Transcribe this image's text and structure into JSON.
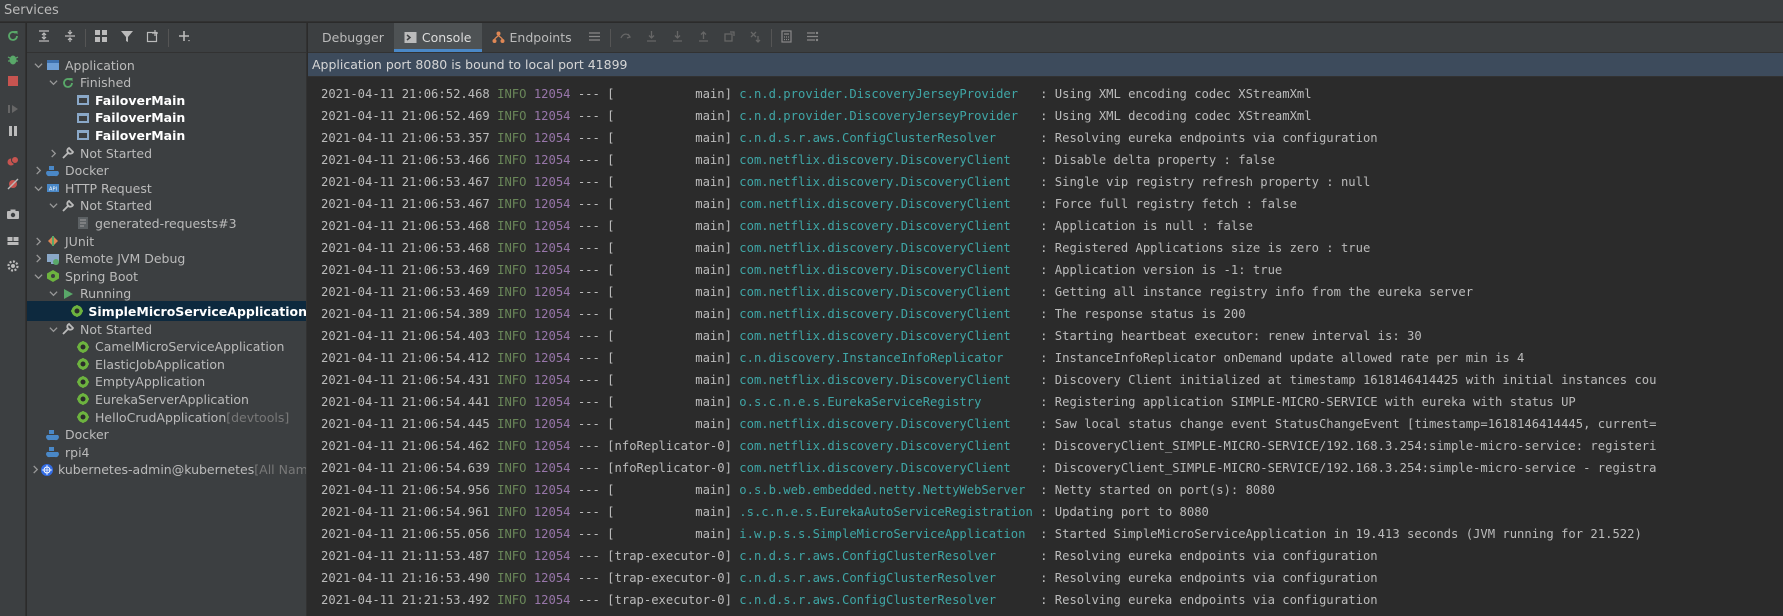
{
  "window": {
    "title": "Services"
  },
  "tree": {
    "rows": [
      {
        "label": "Application",
        "depth": 0,
        "arrow": "down",
        "icon": "app-icon"
      },
      {
        "label": "Finished",
        "depth": 1,
        "arrow": "down",
        "icon": "finished-icon"
      },
      {
        "label": "FailoverMain",
        "depth": 2,
        "arrow": "none",
        "icon": "main-class-icon",
        "bold": true
      },
      {
        "label": "FailoverMain",
        "depth": 2,
        "arrow": "none",
        "icon": "main-class-icon",
        "bold": true
      },
      {
        "label": "FailoverMain",
        "depth": 2,
        "arrow": "none",
        "icon": "main-class-icon",
        "bold": true
      },
      {
        "label": "Not Started",
        "depth": 1,
        "arrow": "right",
        "icon": "wrench-icon"
      },
      {
        "label": "Docker",
        "depth": 0,
        "arrow": "right",
        "icon": "docker-icon"
      },
      {
        "label": "HTTP Request",
        "depth": 0,
        "arrow": "down",
        "icon": "http-request-icon"
      },
      {
        "label": "Not Started",
        "depth": 1,
        "arrow": "down",
        "icon": "wrench-icon"
      },
      {
        "label": "generated-requests#3",
        "depth": 2,
        "arrow": "none",
        "icon": "http-file-icon"
      },
      {
        "label": "JUnit",
        "depth": 0,
        "arrow": "right",
        "icon": "junit-icon"
      },
      {
        "label": "Remote JVM Debug",
        "depth": 0,
        "arrow": "right",
        "icon": "remote-debug-icon"
      },
      {
        "label": "Spring Boot",
        "depth": 0,
        "arrow": "down",
        "icon": "spring-boot-icon"
      },
      {
        "label": "Running",
        "depth": 1,
        "arrow": "down",
        "icon": "running-icon"
      },
      {
        "label": "SimpleMicroServiceApplication",
        "depth": 2,
        "arrow": "none",
        "icon": "spring-app-icon",
        "bold": true,
        "selected": true
      },
      {
        "label": "Not Started",
        "depth": 1,
        "arrow": "down",
        "icon": "wrench-icon"
      },
      {
        "label": "CamelMicroServiceApplication",
        "depth": 2,
        "arrow": "none",
        "icon": "spring-app-icon"
      },
      {
        "label": "ElasticJobApplication",
        "depth": 2,
        "arrow": "none",
        "icon": "spring-app-icon"
      },
      {
        "label": "EmptyApplication",
        "depth": 2,
        "arrow": "none",
        "icon": "spring-app-icon"
      },
      {
        "label": "EurekaServerApplication",
        "depth": 2,
        "arrow": "none",
        "icon": "spring-app-icon"
      },
      {
        "label": "HelloCrudApplication",
        "suffix": " [devtools]",
        "depth": 2,
        "arrow": "none",
        "icon": "spring-app-icon"
      },
      {
        "label": "Docker",
        "depth": 0,
        "arrow": "none",
        "icon": "docker-icon"
      },
      {
        "label": "rpi4",
        "depth": 0,
        "arrow": "none",
        "icon": "docker-icon"
      },
      {
        "label": "kubernetes-admin@kubernetes",
        "suffix": " [All Nam",
        "depth": 0,
        "arrow": "right",
        "icon": "kubernetes-icon"
      }
    ]
  },
  "tabs": {
    "debugger": "Debugger",
    "console": "Console",
    "endpoints": "Endpoints"
  },
  "banner": "Application port 8080 is bound to local port 41899",
  "colors": {
    "accent": "#4a88c7",
    "info": "#6a8759",
    "pid": "#9876aa",
    "logger": "#3fa6a6",
    "spring": "#6db33f",
    "stop": "#c75450"
  },
  "console": {
    "lines": [
      {
        "time": "2021-04-11 21:06:52.468",
        "level": "INFO",
        "pid": "12054",
        "thread": "           main",
        "logger": "c.n.d.provider.DiscoveryJerseyProvider  ",
        "msg": "Using XML encoding codec XStreamXml"
      },
      {
        "time": "2021-04-11 21:06:52.469",
        "level": "INFO",
        "pid": "12054",
        "thread": "           main",
        "logger": "c.n.d.provider.DiscoveryJerseyProvider  ",
        "msg": "Using XML decoding codec XStreamXml"
      },
      {
        "time": "2021-04-11 21:06:53.357",
        "level": "INFO",
        "pid": "12054",
        "thread": "           main",
        "logger": "c.n.d.s.r.aws.ConfigClusterResolver     ",
        "msg": "Resolving eureka endpoints via configuration"
      },
      {
        "time": "2021-04-11 21:06:53.466",
        "level": "INFO",
        "pid": "12054",
        "thread": "           main",
        "logger": "com.netflix.discovery.DiscoveryClient   ",
        "msg": "Disable delta property : false"
      },
      {
        "time": "2021-04-11 21:06:53.467",
        "level": "INFO",
        "pid": "12054",
        "thread": "           main",
        "logger": "com.netflix.discovery.DiscoveryClient   ",
        "msg": "Single vip registry refresh property : null"
      },
      {
        "time": "2021-04-11 21:06:53.467",
        "level": "INFO",
        "pid": "12054",
        "thread": "           main",
        "logger": "com.netflix.discovery.DiscoveryClient   ",
        "msg": "Force full registry fetch : false"
      },
      {
        "time": "2021-04-11 21:06:53.468",
        "level": "INFO",
        "pid": "12054",
        "thread": "           main",
        "logger": "com.netflix.discovery.DiscoveryClient   ",
        "msg": "Application is null : false"
      },
      {
        "time": "2021-04-11 21:06:53.468",
        "level": "INFO",
        "pid": "12054",
        "thread": "           main",
        "logger": "com.netflix.discovery.DiscoveryClient   ",
        "msg": "Registered Applications size is zero : true"
      },
      {
        "time": "2021-04-11 21:06:53.469",
        "level": "INFO",
        "pid": "12054",
        "thread": "           main",
        "logger": "com.netflix.discovery.DiscoveryClient   ",
        "msg": "Application version is -1: true"
      },
      {
        "time": "2021-04-11 21:06:53.469",
        "level": "INFO",
        "pid": "12054",
        "thread": "           main",
        "logger": "com.netflix.discovery.DiscoveryClient   ",
        "msg": "Getting all instance registry info from the eureka server"
      },
      {
        "time": "2021-04-11 21:06:54.389",
        "level": "INFO",
        "pid": "12054",
        "thread": "           main",
        "logger": "com.netflix.discovery.DiscoveryClient   ",
        "msg": "The response status is 200"
      },
      {
        "time": "2021-04-11 21:06:54.403",
        "level": "INFO",
        "pid": "12054",
        "thread": "           main",
        "logger": "com.netflix.discovery.DiscoveryClient   ",
        "msg": "Starting heartbeat executor: renew interval is: 30"
      },
      {
        "time": "2021-04-11 21:06:54.412",
        "level": "INFO",
        "pid": "12054",
        "thread": "           main",
        "logger": "c.n.discovery.InstanceInfoReplicator    ",
        "msg": "InstanceInfoReplicator onDemand update allowed rate per min is 4"
      },
      {
        "time": "2021-04-11 21:06:54.431",
        "level": "INFO",
        "pid": "12054",
        "thread": "           main",
        "logger": "com.netflix.discovery.DiscoveryClient   ",
        "msg": "Discovery Client initialized at timestamp 1618146414425 with initial instances cou"
      },
      {
        "time": "2021-04-11 21:06:54.441",
        "level": "INFO",
        "pid": "12054",
        "thread": "           main",
        "logger": "o.s.c.n.e.s.EurekaServiceRegistry       ",
        "msg": "Registering application SIMPLE-MICRO-SERVICE with eureka with status UP"
      },
      {
        "time": "2021-04-11 21:06:54.445",
        "level": "INFO",
        "pid": "12054",
        "thread": "           main",
        "logger": "com.netflix.discovery.DiscoveryClient   ",
        "msg": "Saw local status change event StatusChangeEvent [timestamp=1618146414445, current="
      },
      {
        "time": "2021-04-11 21:06:54.462",
        "level": "INFO",
        "pid": "12054",
        "thread": "nfoReplicator-0",
        "logger": "com.netflix.discovery.DiscoveryClient   ",
        "msg": "DiscoveryClient_SIMPLE-MICRO-SERVICE/192.168.3.254:simple-micro-service: registeri"
      },
      {
        "time": "2021-04-11 21:06:54.639",
        "level": "INFO",
        "pid": "12054",
        "thread": "nfoReplicator-0",
        "logger": "com.netflix.discovery.DiscoveryClient   ",
        "msg": "DiscoveryClient_SIMPLE-MICRO-SERVICE/192.168.3.254:simple-micro-service - registra"
      },
      {
        "time": "2021-04-11 21:06:54.956",
        "level": "INFO",
        "pid": "12054",
        "thread": "           main",
        "logger": "o.s.b.web.embedded.netty.NettyWebServer ",
        "msg": "Netty started on port(s): 8080"
      },
      {
        "time": "2021-04-11 21:06:54.961",
        "level": "INFO",
        "pid": "12054",
        "thread": "           main",
        "logger": ".s.c.n.e.s.EurekaAutoServiceRegistration",
        "msg": "Updating port to 8080"
      },
      {
        "time": "2021-04-11 21:06:55.056",
        "level": "INFO",
        "pid": "12054",
        "thread": "           main",
        "logger": "i.w.p.s.s.SimpleMicroServiceApplication ",
        "msg": "Started SimpleMicroServiceApplication in 19.413 seconds (JVM running for 21.522)"
      },
      {
        "time": "2021-04-11 21:11:53.487",
        "level": "INFO",
        "pid": "12054",
        "thread": "trap-executor-0",
        "logger": "c.n.d.s.r.aws.ConfigClusterResolver     ",
        "msg": "Resolving eureka endpoints via configuration"
      },
      {
        "time": "2021-04-11 21:16:53.490",
        "level": "INFO",
        "pid": "12054",
        "thread": "trap-executor-0",
        "logger": "c.n.d.s.r.aws.ConfigClusterResolver     ",
        "msg": "Resolving eureka endpoints via configuration"
      },
      {
        "time": "2021-04-11 21:21:53.492",
        "level": "INFO",
        "pid": "12054",
        "thread": "trap-executor-0",
        "logger": "c.n.d.s.r.aws.ConfigClusterResolver     ",
        "msg": "Resolving eureka endpoints via configuration"
      }
    ]
  }
}
